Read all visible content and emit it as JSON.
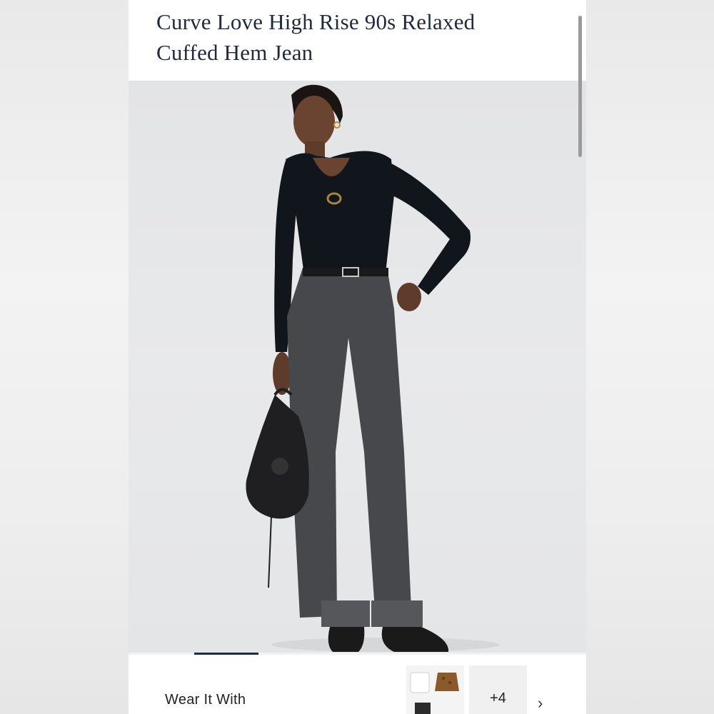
{
  "product": {
    "title_line1": "Curve Love High Rise 90s Relaxed",
    "title_line2": "Cuffed Hem Jean"
  },
  "gallery": {
    "progress": 0.14
  },
  "wear_it_with": {
    "label": "Wear It With",
    "more_count": "+4",
    "chevron_icon": "chevron-right-icon"
  },
  "colors": {
    "title": "#1f2a3d",
    "background": "#e4e5e7",
    "top": "#11151c",
    "denim": "#46484b"
  }
}
